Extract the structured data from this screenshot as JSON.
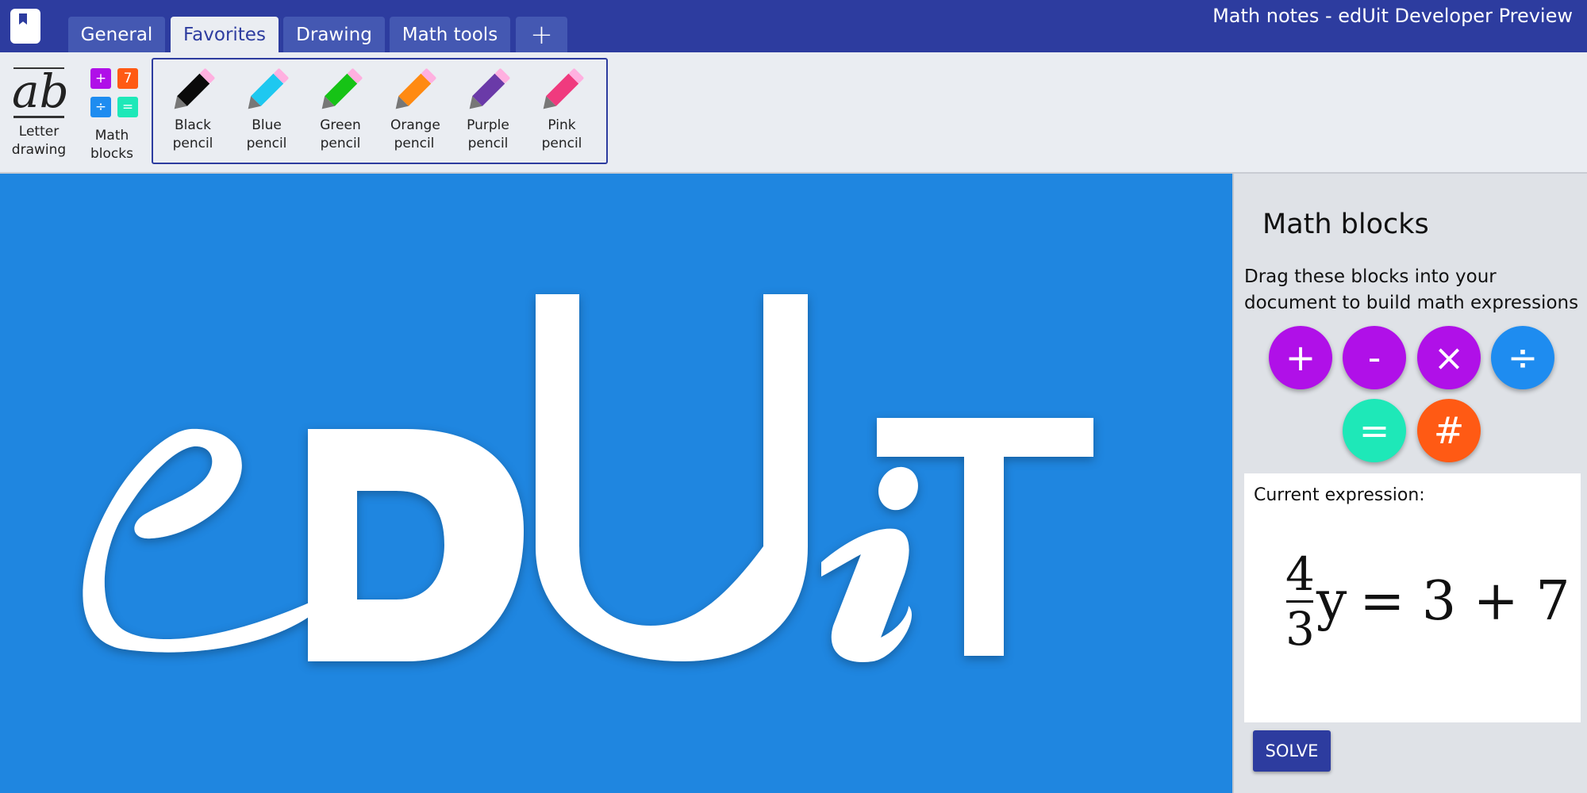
{
  "window": {
    "title": "Math notes - edUit Developer Preview"
  },
  "tabs": [
    {
      "label": "General"
    },
    {
      "label": "Favorites",
      "active": true
    },
    {
      "label": "Drawing"
    },
    {
      "label": "Math tools"
    },
    {
      "label": "+"
    }
  ],
  "ribbon": {
    "letter_drawing": {
      "label": "Letter drawing",
      "glyph": "ab"
    },
    "math_blocks": {
      "label": "Math blocks",
      "symbols": [
        "+",
        "7",
        "÷",
        "="
      ]
    },
    "pencils": [
      {
        "label": "Black pencil",
        "color": "#0a0a0a"
      },
      {
        "label": "Blue pencil",
        "color": "#1ec8f0"
      },
      {
        "label": "Green pencil",
        "color": "#16c316"
      },
      {
        "label": "Orange pencil",
        "color": "#ff8a12"
      },
      {
        "label": "Purple pencil",
        "color": "#6a3aa8"
      },
      {
        "label": "Pink pencil",
        "color": "#f03a7e"
      }
    ]
  },
  "canvas": {
    "logo_text": "eDUiT"
  },
  "panel": {
    "title": "Math blocks",
    "description": "Drag these blocks into your document to build math expressions",
    "blocks": [
      {
        "symbol": "+",
        "color": "#b010e8"
      },
      {
        "symbol": "-",
        "color": "#b010e8"
      },
      {
        "symbol": "×",
        "color": "#b010e8"
      },
      {
        "symbol": "÷",
        "color": "#1e8cf0"
      },
      {
        "symbol": "=",
        "color": "#1ee8b8"
      },
      {
        "symbol": "#",
        "color": "#ff5a14"
      }
    ],
    "expression": {
      "label": "Current expression:",
      "numerator": "4",
      "denominator": "3",
      "variable": "y",
      "rest": "= 3 + 7"
    },
    "solve_label": "SOLVE"
  },
  "colors": {
    "titlebar": "#2d3c9f",
    "ribbon": "#eaedf2",
    "canvas": "#1f86e0",
    "panel": "#dfe2e7"
  }
}
